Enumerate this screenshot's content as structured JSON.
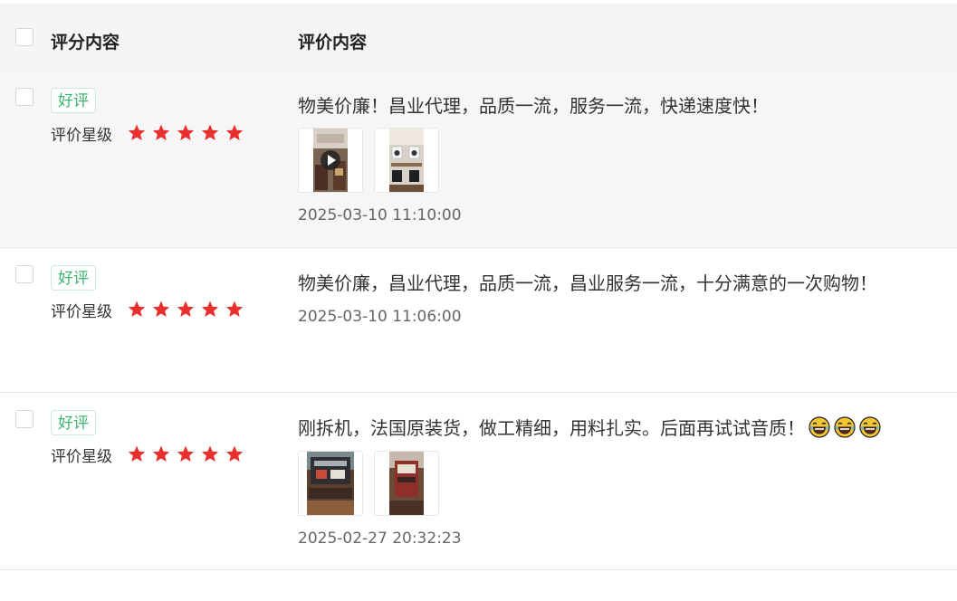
{
  "header": {
    "col_rating": "评分内容",
    "col_review": "评价内容"
  },
  "rows": [
    {
      "badge": "好评",
      "rating_label": "评价星级",
      "stars": 5,
      "content": "物美价廉！昌业代理，品质一流，服务一流，快递速度快！",
      "images": [
        {
          "kind": "video-thumbnail",
          "icon": "play-icon"
        },
        {
          "kind": "photo-thumbnail"
        }
      ],
      "time": "2025-03-10 11:10:00"
    },
    {
      "badge": "好评",
      "rating_label": "评价星级",
      "stars": 5,
      "content": "物美价廉，昌业代理，品质一流，昌业服务一流，十分满意的一次购物！",
      "images": [],
      "time": "2025-03-10 11:06:00"
    },
    {
      "badge": "好评",
      "rating_label": "评价星级",
      "stars": 5,
      "content": "刚拆机，法国原装货，做工精细，用料扎实。后面再试试音质！",
      "emojis": [
        "laughing-tears-emoji",
        "laughing-tears-emoji",
        "laughing-tears-emoji"
      ],
      "images": [
        {
          "kind": "photo-thumbnail"
        },
        {
          "kind": "photo-thumbnail"
        }
      ],
      "time": "2025-02-27 20:32:23"
    }
  ],
  "colors": {
    "badge_green": "#3cb46e",
    "star_red": "#e8302e",
    "header_bg": "#f5f5f5",
    "hover_row_bg": "#f6f6f6"
  }
}
